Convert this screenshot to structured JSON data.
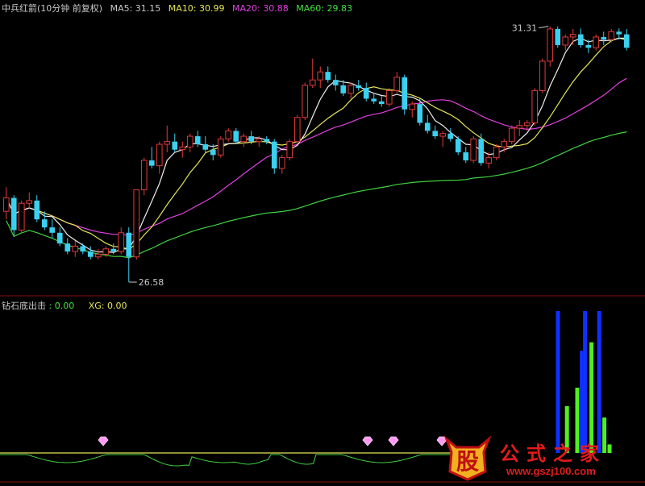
{
  "header": {
    "title": "中兵红箭(10分钟 前复权)",
    "ma5": "MA5: 31.15",
    "ma10": "MA10: 30.99",
    "ma20": "MA20: 30.88",
    "ma60": "MA60: 29.83"
  },
  "indicator_header": {
    "name": "钻石底出击",
    "value": ": 0.00",
    "xg": "XG: 0.00"
  },
  "colors": {
    "background": "#000000",
    "up": "#e03a3a",
    "down": "#3ad0f0",
    "ma5": "#f0f0f0",
    "ma10": "#e6e65a",
    "ma20": "#e040e0",
    "ma60": "#40d040",
    "bar_blue": "#1030ff",
    "bar_green": "#50f020",
    "baseline": "#e6e65a",
    "osc": "#40d040",
    "diamond": "#ff9af0"
  },
  "chart_data": [
    {
      "type": "candlestick",
      "ylim": [
        26.4,
        31.6
      ],
      "annotations": [
        {
          "label": "31.31"
        },
        {
          "label": "26.58"
        }
      ],
      "candles": [
        [
          27.9,
          28.35,
          27.75,
          28.15
        ],
        [
          28.15,
          28.2,
          27.45,
          27.55
        ],
        [
          27.55,
          28.1,
          27.5,
          28.05
        ],
        [
          28.05,
          28.25,
          27.95,
          28.1
        ],
        [
          28.1,
          28.2,
          27.7,
          27.75
        ],
        [
          27.75,
          27.9,
          27.55,
          27.6
        ],
        [
          27.6,
          27.75,
          27.4,
          27.5
        ],
        [
          27.5,
          27.6,
          27.25,
          27.3
        ],
        [
          27.3,
          27.4,
          27.1,
          27.15
        ],
        [
          27.15,
          27.35,
          27.05,
          27.25
        ],
        [
          27.25,
          27.3,
          27.1,
          27.15
        ],
        [
          27.15,
          27.25,
          27.0,
          27.05
        ],
        [
          27.05,
          27.2,
          27.0,
          27.1
        ],
        [
          27.1,
          27.25,
          27.05,
          27.2
        ],
        [
          27.2,
          27.3,
          27.1,
          27.15
        ],
        [
          27.15,
          27.6,
          27.1,
          27.5
        ],
        [
          27.5,
          27.6,
          26.58,
          27.05
        ],
        [
          27.05,
          28.3,
          27.0,
          28.3
        ],
        [
          28.3,
          28.9,
          28.2,
          28.85
        ],
        [
          28.85,
          29.1,
          28.7,
          28.75
        ],
        [
          28.75,
          29.2,
          28.6,
          29.15
        ],
        [
          29.15,
          29.5,
          29.0,
          29.2
        ],
        [
          29.2,
          29.35,
          29.0,
          29.05
        ],
        [
          29.05,
          29.2,
          28.9,
          29.1
        ],
        [
          29.1,
          29.35,
          29.0,
          29.3
        ],
        [
          29.3,
          29.4,
          29.1,
          29.15
        ],
        [
          29.15,
          29.3,
          29.0,
          29.05
        ],
        [
          29.05,
          29.15,
          28.85,
          28.95
        ],
        [
          28.95,
          29.3,
          28.9,
          29.25
        ],
        [
          29.25,
          29.45,
          29.2,
          29.4
        ],
        [
          29.4,
          29.45,
          29.15,
          29.2
        ],
        [
          29.2,
          29.35,
          29.1,
          29.3
        ],
        [
          29.3,
          29.4,
          29.15,
          29.2
        ],
        [
          29.2,
          29.3,
          29.1,
          29.25
        ],
        [
          29.25,
          29.3,
          29.15,
          29.2
        ],
        [
          29.2,
          29.25,
          28.6,
          28.7
        ],
        [
          28.7,
          28.95,
          28.6,
          28.9
        ],
        [
          28.9,
          29.25,
          28.85,
          29.2
        ],
        [
          29.2,
          29.7,
          29.15,
          29.65
        ],
        [
          29.65,
          30.3,
          29.6,
          30.25
        ],
        [
          30.25,
          30.75,
          30.2,
          30.35
        ],
        [
          30.35,
          30.6,
          30.2,
          30.5
        ],
        [
          30.5,
          30.6,
          30.3,
          30.35
        ],
        [
          30.35,
          30.45,
          30.15,
          30.25
        ],
        [
          30.25,
          30.35,
          30.05,
          30.1
        ],
        [
          30.1,
          30.3,
          30.0,
          30.25
        ],
        [
          30.25,
          30.35,
          30.15,
          30.2
        ],
        [
          30.2,
          30.3,
          29.95,
          30.0
        ],
        [
          30.0,
          30.1,
          29.9,
          29.95
        ],
        [
          29.95,
          30.05,
          29.85,
          29.9
        ],
        [
          29.9,
          30.2,
          29.85,
          30.15
        ],
        [
          30.15,
          30.5,
          30.1,
          30.4
        ],
        [
          30.4,
          30.45,
          29.7,
          29.8
        ],
        [
          29.8,
          29.95,
          29.65,
          29.9
        ],
        [
          29.9,
          30.0,
          29.5,
          29.55
        ],
        [
          29.55,
          29.7,
          29.35,
          29.4
        ],
        [
          29.4,
          29.5,
          29.25,
          29.3
        ],
        [
          29.3,
          29.4,
          29.1,
          29.35
        ],
        [
          29.35,
          29.45,
          29.2,
          29.25
        ],
        [
          29.25,
          29.3,
          28.95,
          29.0
        ],
        [
          29.0,
          29.1,
          28.8,
          28.85
        ],
        [
          28.85,
          29.3,
          28.8,
          29.25
        ],
        [
          29.25,
          29.35,
          28.75,
          28.8
        ],
        [
          28.8,
          29.0,
          28.7,
          28.9
        ],
        [
          28.9,
          29.15,
          28.85,
          29.1
        ],
        [
          29.1,
          29.25,
          29.0,
          29.2
        ],
        [
          29.2,
          29.5,
          29.15,
          29.45
        ],
        [
          29.45,
          29.6,
          29.3,
          29.5
        ],
        [
          29.5,
          29.6,
          29.4,
          29.55
        ],
        [
          29.55,
          30.2,
          29.5,
          30.15
        ],
        [
          30.15,
          30.75,
          30.1,
          30.7
        ],
        [
          30.7,
          31.35,
          30.6,
          31.3
        ],
        [
          31.3,
          31.35,
          30.95,
          31.0
        ],
        [
          31.0,
          31.2,
          30.9,
          31.15
        ],
        [
          31.15,
          31.3,
          31.0,
          31.2
        ],
        [
          31.2,
          31.31,
          30.95,
          31.0
        ],
        [
          31.0,
          31.1,
          30.85,
          30.95
        ],
        [
          30.95,
          31.2,
          30.9,
          31.15
        ],
        [
          31.15,
          31.25,
          31.0,
          31.1
        ],
        [
          31.1,
          31.3,
          31.05,
          31.25
        ],
        [
          31.25,
          31.31,
          31.1,
          31.2
        ],
        [
          31.2,
          31.3,
          30.9,
          30.95
        ]
      ]
    },
    {
      "type": "bar",
      "bars": [
        {
          "color": "blue",
          "pos": 0.865,
          "value": 1.0
        },
        {
          "color": "blue",
          "pos": 0.902,
          "value": 0.72
        },
        {
          "color": "blue",
          "pos": 0.907,
          "value": 1.0
        },
        {
          "color": "blue",
          "pos": 0.929,
          "value": 1.0
        },
        {
          "color": "green",
          "pos": 0.879,
          "value": 0.33
        },
        {
          "color": "green",
          "pos": 0.895,
          "value": 0.46
        },
        {
          "color": "green",
          "pos": 0.917,
          "value": 0.78
        },
        {
          "color": "green",
          "pos": 0.937,
          "value": 0.25
        },
        {
          "color": "green",
          "pos": 0.945,
          "value": 0.06
        }
      ],
      "diamonds": [
        0.16,
        0.57,
        0.61,
        0.685
      ]
    }
  ],
  "watermark": {
    "title": "公式之家",
    "url": "www.gszj100.com",
    "logo_char": "股"
  }
}
